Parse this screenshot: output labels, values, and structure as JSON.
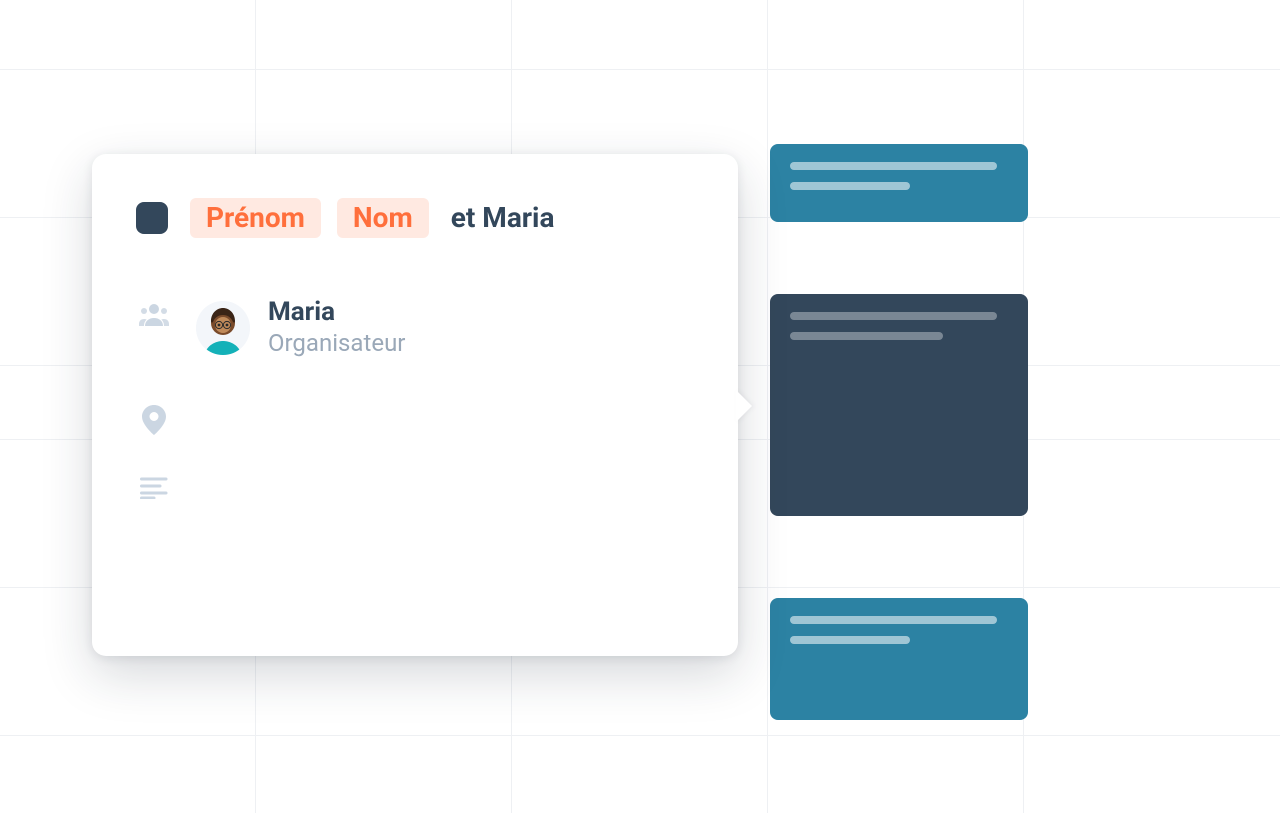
{
  "popover": {
    "title": {
      "chip_first": "Prénom",
      "chip_last": "Nom",
      "suffix": "et Maria"
    },
    "organizer": {
      "name": "Maria",
      "role": "Organisateur"
    }
  },
  "colors": {
    "accent_orange": "#ff6f3c",
    "navy": "#33475b",
    "teal": "#2c82a3"
  },
  "icons": {
    "people": "people-icon",
    "location": "location-pin-icon",
    "description": "text-lines-icon"
  }
}
